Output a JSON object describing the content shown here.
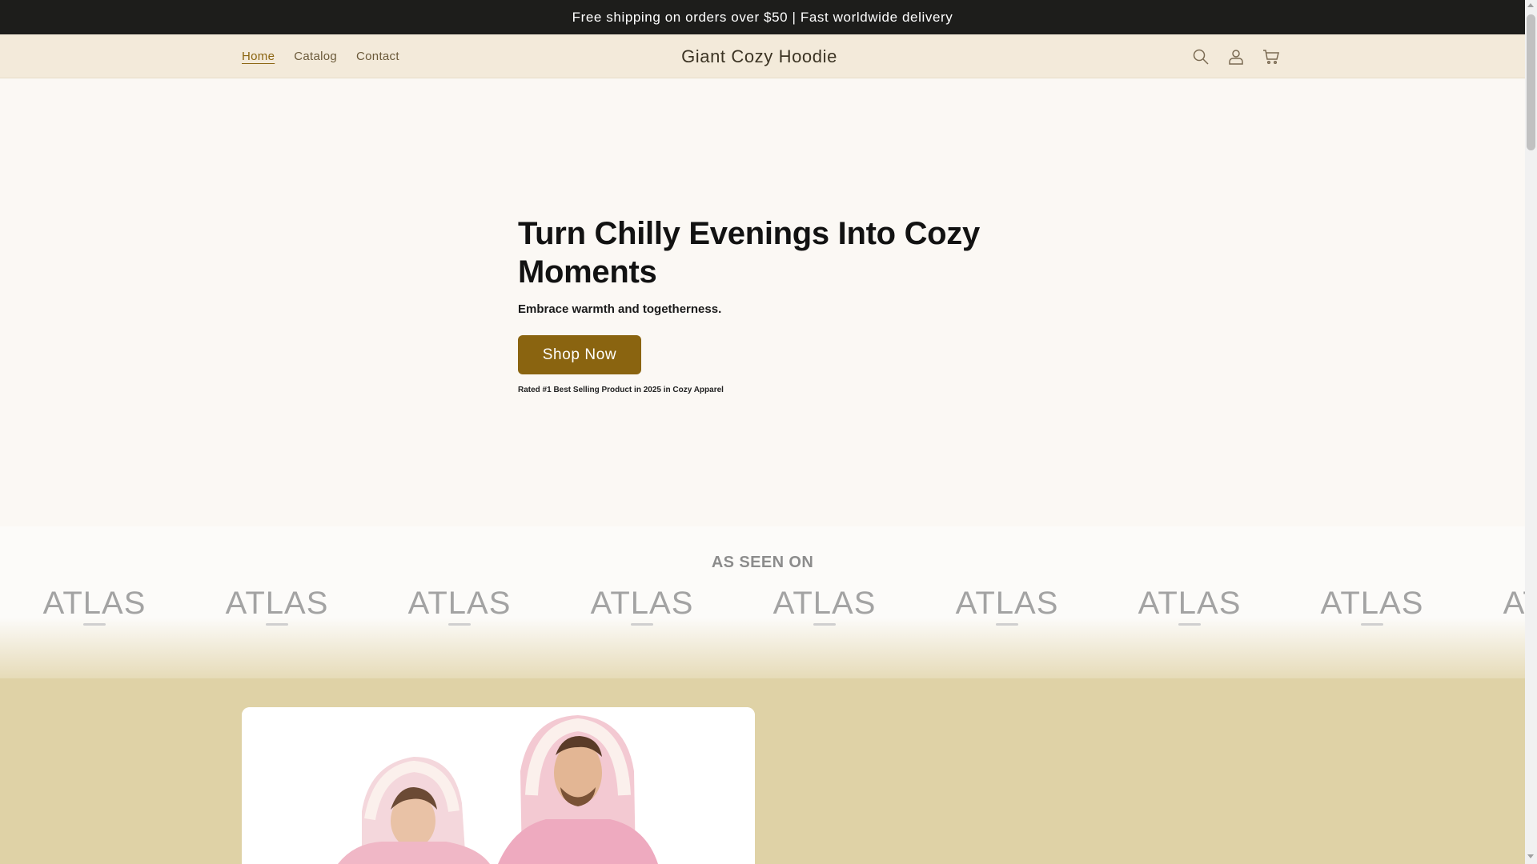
{
  "announcement": {
    "text": "Free shipping on orders over $50 | Fast worldwide delivery"
  },
  "header": {
    "nav": [
      {
        "label": "Home",
        "active": true
      },
      {
        "label": "Catalog",
        "active": false
      },
      {
        "label": "Contact",
        "active": false
      }
    ],
    "logo": "Giant Cozy Hoodie",
    "icons": [
      "search-icon",
      "account-icon",
      "cart-icon"
    ]
  },
  "hero": {
    "title": "Turn Chilly Evenings Into Cozy Moments",
    "subtitle": "Embrace warmth and togetherness.",
    "cta_label": "Shop Now",
    "rated_text": "Rated #1 Best Selling Product in 2025 in Cozy Apparel"
  },
  "as_seen_on": {
    "title": "AS SEEN ON",
    "logos": [
      "ATLAS",
      "ATLAS",
      "ATLAS",
      "ATLAS",
      "ATLAS",
      "ATLAS",
      "ATLAS",
      "ATLAS",
      "ATLAS"
    ]
  },
  "product": {
    "image": "pink-hoodie-models-image"
  },
  "colors": {
    "accent": "#8a6410",
    "announcement_bg": "#1d1d1b",
    "header_bg": "#f3eada",
    "product_section_bg": "#dfd2a6"
  }
}
